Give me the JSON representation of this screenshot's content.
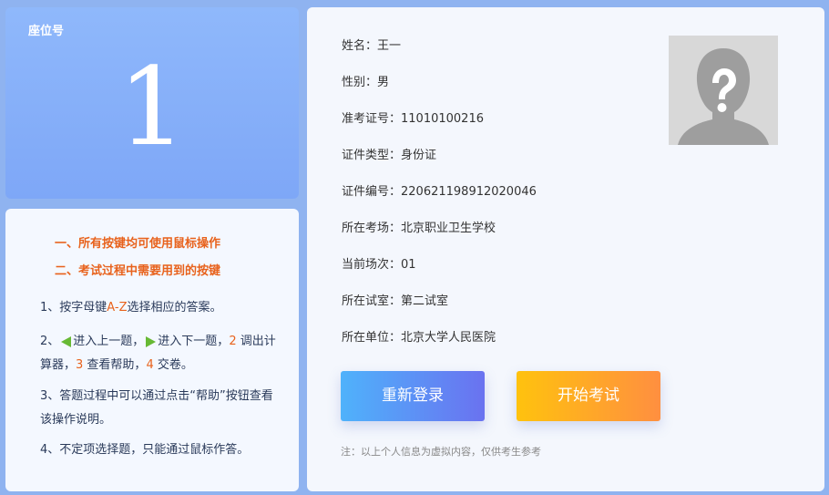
{
  "seat": {
    "label": "座位号",
    "number": "1"
  },
  "guide": {
    "heading1": "一、所有按键均可使用鼠标操作",
    "heading2": "二、考试过程中需要用到的按键",
    "item1_prefix": "1、按字母键",
    "item1_keys": "A-Z",
    "item1_suffix": "选择相应的答案。",
    "item2_prefix": "2、",
    "item2_prev": "进入上一题，",
    "item2_next": "进入下一题，",
    "item2_key2": "2",
    "item2_calc": " 调出计算器，",
    "item2_key3": "3",
    "item2_help": " 查看帮助，",
    "item2_key4": "4",
    "item2_submit": " 交卷。",
    "item3": "3、答题过程中可以通过点击“帮助”按钮查看该操作说明。",
    "item4": "4、不定项选择题，只能通过鼠标作答。"
  },
  "info": {
    "name": "姓名：王一",
    "gender": "性别：男",
    "ticket": "准考证号：11010100216",
    "id_type": "证件类型：身份证",
    "id_number": "证件编号：220621198912020046",
    "venue": "所在考场：北京职业卫生学校",
    "session": "当前场次：01",
    "room": "所在试室：第二试室",
    "org": "所在单位：北京大学人民医院"
  },
  "buttons": {
    "relogin": "重新登录",
    "start": "开始考试"
  },
  "note": "注：以上个人信息为虚拟内容，仅供考生参考",
  "colors": {
    "accent_orange": "#e8621c",
    "arrow_green": "#67b934"
  }
}
